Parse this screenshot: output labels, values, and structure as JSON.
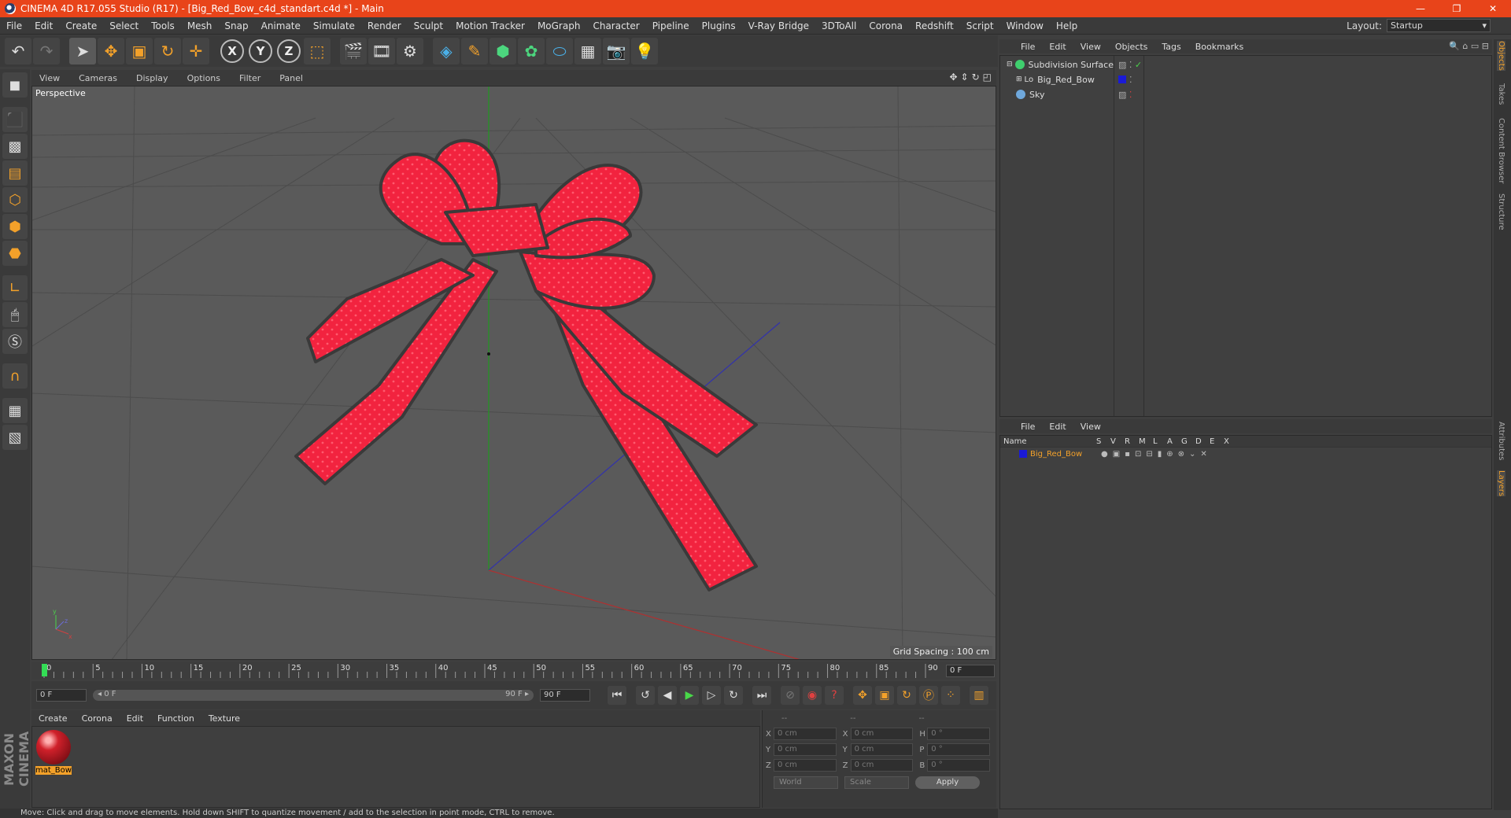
{
  "window": {
    "title": "CINEMA 4D R17.055 Studio (R17) - [Big_Red_Bow_c4d_standart.c4d *] - Main",
    "minimize": "—",
    "restore": "❐",
    "close": "✕"
  },
  "menubar": {
    "items": [
      "File",
      "Edit",
      "Create",
      "Select",
      "Tools",
      "Mesh",
      "Snap",
      "Animate",
      "Simulate",
      "Render",
      "Sculpt",
      "Motion Tracker",
      "MoGraph",
      "Character",
      "Pipeline",
      "Plugins",
      "V-Ray Bridge",
      "3DToAll",
      "Corona",
      "Redshift",
      "Script",
      "Window",
      "Help"
    ],
    "layout_label": "Layout:",
    "layout_value": "Startup"
  },
  "viewport": {
    "menu": [
      "View",
      "Cameras",
      "Display",
      "Options",
      "Filter",
      "Panel"
    ],
    "camera_label": "Perspective",
    "grid_spacing": "Grid Spacing : 100 cm"
  },
  "timeline": {
    "ticks": [
      "0",
      "5",
      "10",
      "15",
      "20",
      "25",
      "30",
      "35",
      "40",
      "45",
      "50",
      "55",
      "60",
      "65",
      "70",
      "75",
      "80",
      "85",
      "90"
    ],
    "current_frame": "0 F",
    "start_field": "0 F",
    "slider_start": "◂ 0 F",
    "slider_end": "90 F ▸",
    "end_field": "90 F"
  },
  "material_manager": {
    "menu": [
      "Create",
      "Corona",
      "Edit",
      "Function",
      "Texture"
    ],
    "materials": [
      {
        "name": "mat_Bow"
      }
    ]
  },
  "coordinates": {
    "headers": [
      "--",
      "--",
      "--"
    ],
    "rows": [
      {
        "a": "X",
        "av": "0 cm",
        "b": "X",
        "bv": "0 cm",
        "c": "H",
        "cv": "0 °"
      },
      {
        "a": "Y",
        "av": "0 cm",
        "b": "Y",
        "bv": "0 cm",
        "c": "P",
        "cv": "0 °"
      },
      {
        "a": "Z",
        "av": "0 cm",
        "b": "Z",
        "bv": "0 cm",
        "c": "B",
        "cv": "0 °"
      }
    ],
    "space": "World",
    "mode": "Scale",
    "apply": "Apply"
  },
  "status": "Move: Click and drag to move elements. Hold down SHIFT to quantize movement / add to the selection in point mode, CTRL to remove.",
  "object_manager": {
    "menu": [
      "File",
      "Edit",
      "View",
      "Objects",
      "Tags",
      "Bookmarks"
    ],
    "objects": [
      {
        "name": "Subdivision Surface",
        "icon_color": "#3fcf6e"
      },
      {
        "name": "Big_Red_Bow",
        "icon_color": "#d8d8d8"
      },
      {
        "name": "Sky",
        "icon_color": "#6fa8dc"
      }
    ]
  },
  "layer_manager": {
    "menu": [
      "File",
      "Edit",
      "View"
    ],
    "columns": [
      "Name",
      "S",
      "V",
      "R",
      "M",
      "L",
      "A",
      "G",
      "D",
      "E",
      "X"
    ],
    "layers": [
      {
        "name": "Big_Red_Bow",
        "color": "#1a1ad6"
      }
    ]
  },
  "side_tabs": [
    "Objects",
    "Takes",
    "Content Browser",
    "Structure",
    "Attributes",
    "Layers"
  ],
  "brand": "MAXON CINEMA 4D",
  "colors": {
    "accent": "#f3a12a",
    "title_bar": "#e8441a",
    "bow_red": "#f4233f"
  }
}
